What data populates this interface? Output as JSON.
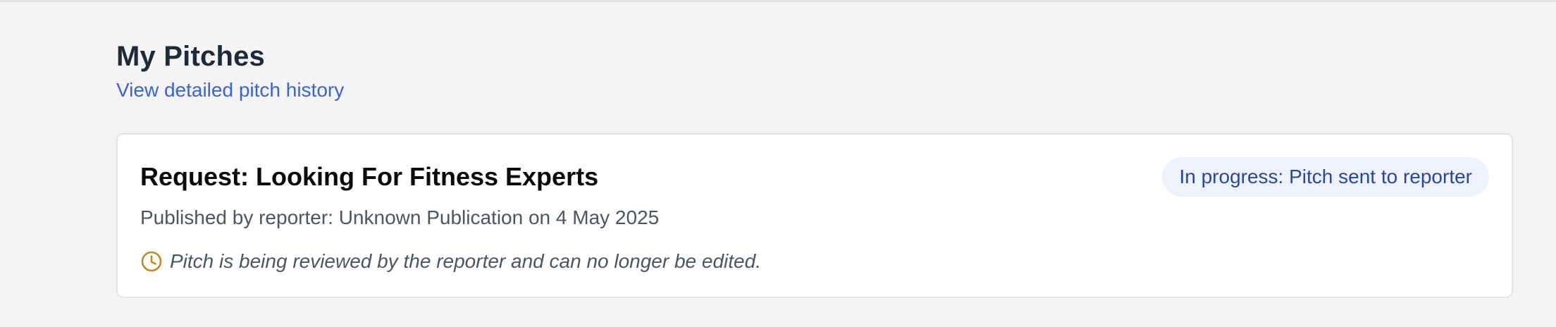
{
  "header": {
    "title": "My Pitches",
    "history_link": "View detailed pitch history"
  },
  "pitch_card": {
    "title": "Request: Looking For Fitness Experts",
    "status": "In progress: Pitch sent to reporter",
    "meta": "Published by reporter: Unknown Publication on 4 May 2025",
    "notice": "Pitch is being reviewed by the reporter and can no longer be edited.",
    "notice_icon": "clock-icon"
  },
  "colors": {
    "link": "#3b63d1",
    "status_bg": "#eef3fb",
    "status_text": "#2a45a6",
    "clock_icon": "#c08a1e"
  }
}
